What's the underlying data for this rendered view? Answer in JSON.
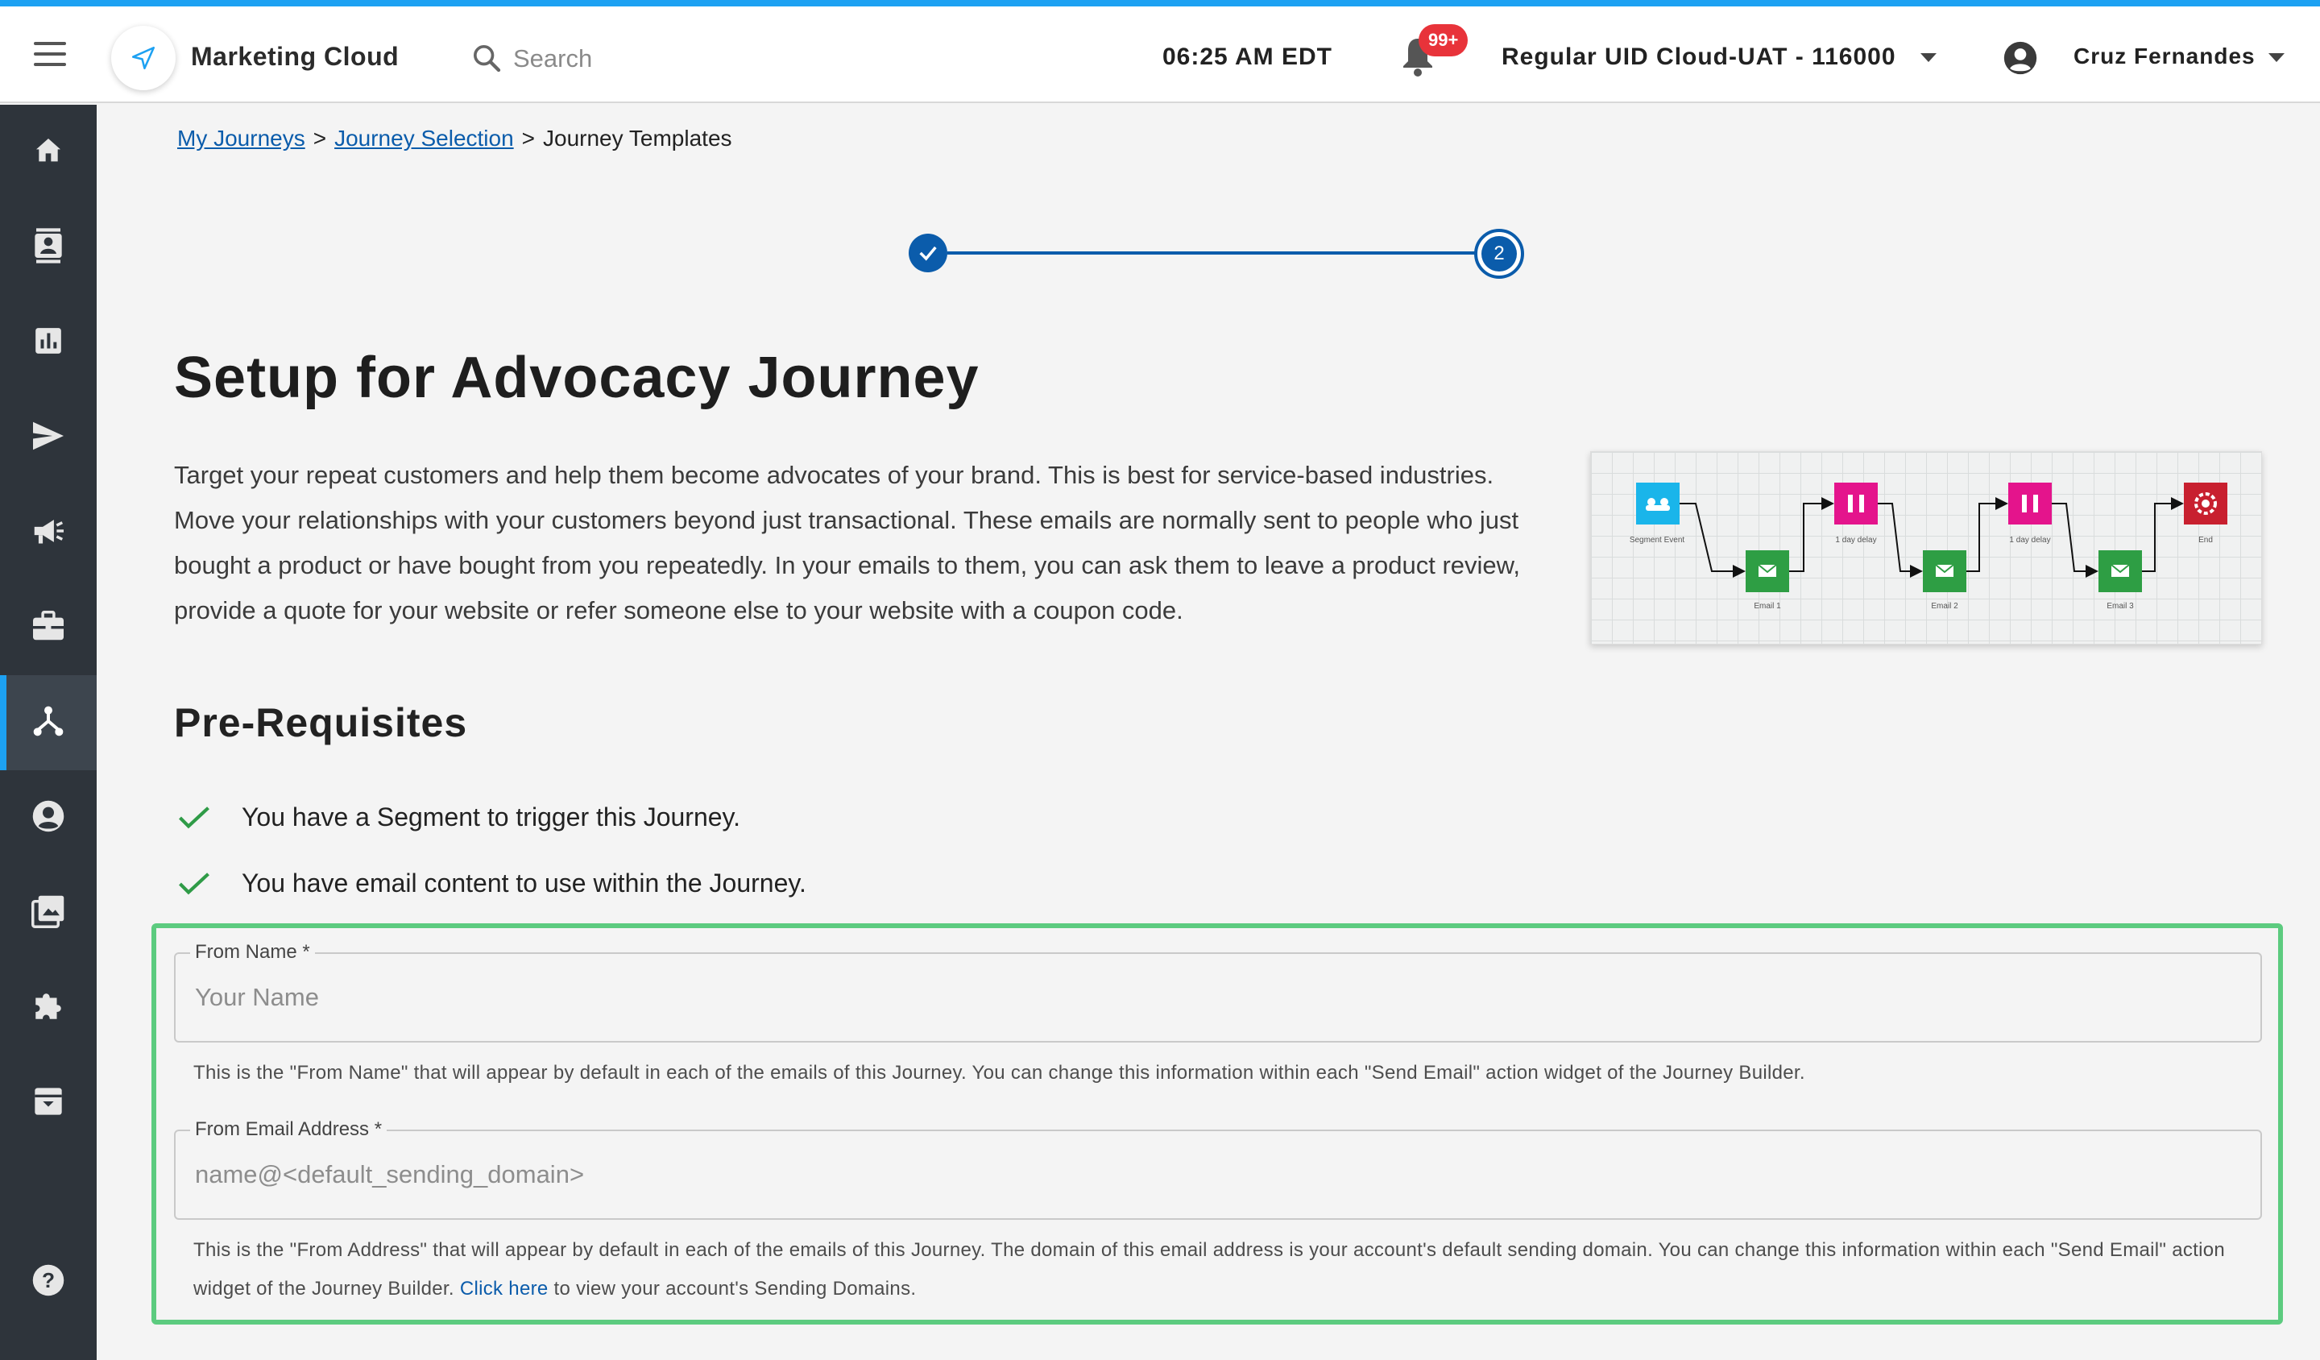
{
  "header": {
    "app_title": "Marketing Cloud",
    "search_placeholder": "Search",
    "clock": "06:25 AM EDT",
    "notification_badge": "99+",
    "account_name": "Regular UID Cloud-UAT - 116000",
    "user_name": "Cruz Fernandes"
  },
  "sidebar": {
    "items": [
      {
        "icon": "home-icon"
      },
      {
        "icon": "contacts-icon"
      },
      {
        "icon": "analytics-icon"
      },
      {
        "icon": "send-icon"
      },
      {
        "icon": "campaign-icon"
      },
      {
        "icon": "briefcase-icon"
      },
      {
        "icon": "journey-icon",
        "active": true
      },
      {
        "icon": "account-icon"
      },
      {
        "icon": "images-icon"
      },
      {
        "icon": "puzzle-icon"
      },
      {
        "icon": "archive-icon"
      },
      {
        "icon": "help-icon"
      }
    ]
  },
  "breadcrumb": {
    "items": [
      "My Journeys",
      "Journey Selection",
      "Journey Templates"
    ],
    "separator": ">"
  },
  "stepper": {
    "current_step": "2"
  },
  "page": {
    "title": "Setup for Advocacy Journey",
    "description": "Target your repeat customers and help them become advocates of your brand. This is best for service-based industries. Move your relationships with your customers beyond just transactional. These emails are normally sent to people who just bought a product or have bought from you repeatedly. In your emails to them, you can ask them to leave a product review, provide a quote for your website or refer someone else to your website with a coupon code."
  },
  "diagram": {
    "nodes": [
      "Segment Event",
      "Email 1",
      "1 day delay",
      "Email 2",
      "1 day delay",
      "Email 3",
      "End"
    ]
  },
  "prerequisites": {
    "title": "Pre-Requisites",
    "items": [
      "You have a Segment to trigger this Journey.",
      "You have email content to use within the Journey."
    ]
  },
  "form": {
    "from_name": {
      "label": "From Name *",
      "placeholder": "Your Name",
      "help": "This is the \"From Name\" that will appear by default in each of the emails of this Journey. You can change this information within each \"Send Email\" action widget of the Journey Builder."
    },
    "from_email": {
      "label": "From Email Address *",
      "placeholder": "name@<default_sending_domain>",
      "help_before": "This is the \"From Address\" that will appear by default in each of the emails of this Journey. The domain of this email address is your account's default sending domain. You can change this information within each \"Send Email\" action widget of the Journey Builder.",
      "help_link": "Click here",
      "help_after": "to view your account's Sending Domains."
    }
  },
  "colors": {
    "accent": "#0b5cab",
    "highlight_border": "#5ccb7f",
    "sidebar": "#2e343b",
    "top_strip": "#1da1f2",
    "segment_node": "#1ab5ea",
    "email_node": "#2e9e44",
    "delay_node": "#e4148c",
    "end_node": "#c8202f"
  }
}
